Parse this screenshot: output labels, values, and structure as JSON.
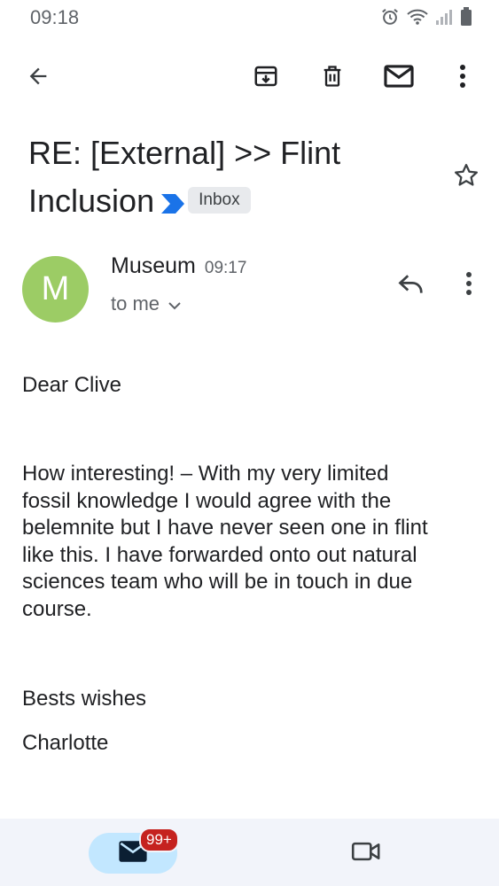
{
  "status_bar": {
    "time": "09:18",
    "icons": [
      "alarm-icon",
      "wifi-icon",
      "signal-icon",
      "battery-icon"
    ]
  },
  "toolbar": {
    "actions": [
      "back-icon",
      "archive-icon",
      "delete-icon",
      "mark-unread-icon",
      "more-vert-icon"
    ]
  },
  "email": {
    "subject_line1": "RE: [External] >> Flint",
    "subject_line2": "Inclusion",
    "label": "Inbox",
    "importance_color": "#1a73e8",
    "sender": {
      "avatar_letter": "M",
      "avatar_color": "#9ccc65",
      "name": "Museum",
      "time": "09:17",
      "recipient": "to me"
    },
    "body": {
      "greeting": "Dear Clive",
      "paragraph": [
        "How interesting! – With my very limited",
        "fossil knowledge I would agree with the",
        "belemnite but I have never seen one in flint",
        "like this. I have forwarded onto out natural",
        "sciences team who will be in touch in due",
        "course."
      ],
      "closing": "Bests wishes",
      "signature": "Charlotte"
    }
  },
  "bottom_nav": {
    "mail_badge": "99+",
    "accent_color": "#c2e7ff",
    "badge_color": "#c5221f"
  }
}
